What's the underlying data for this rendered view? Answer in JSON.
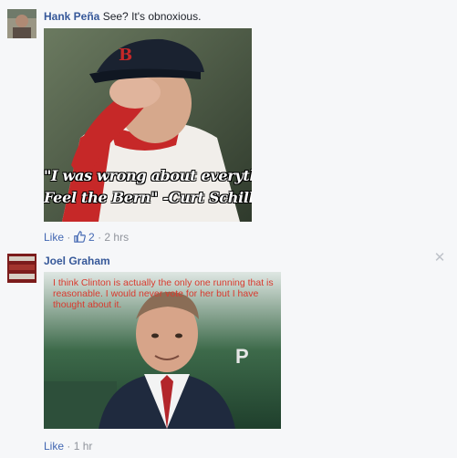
{
  "comments": [
    {
      "author": "Hank Peña",
      "text": "See? It's obnoxious.",
      "image_caption_line1": "\"I was wrong about everything.",
      "image_caption_line2": "Feel the Bern\" -Curt Schilling",
      "like_label": "Like",
      "like_count": "2",
      "separator": "·",
      "time": "2 hrs"
    },
    {
      "author": "Joel Graham",
      "image_overlay_text": "I think Clinton is actually the only one running that is reasonable. I would never vote for her but I have thought about it.",
      "like_label": "Like",
      "separator": "·",
      "time": "1 hr"
    }
  ],
  "icons": {
    "thumb": "thumbs-up-icon",
    "close": "close-icon"
  },
  "colors": {
    "link": "#365899",
    "meta": "#90949c",
    "background": "#f6f7f9",
    "overlay_text": "#d93a2e"
  }
}
